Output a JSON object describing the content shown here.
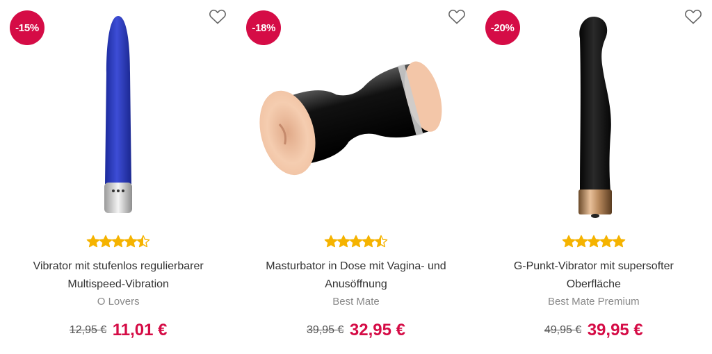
{
  "products": [
    {
      "discount": "-15%",
      "title_line1": "Vibrator mit stufenlos regulierbarer",
      "title_line2": "Multispeed-Vibration",
      "brand": "O Lovers",
      "old_price": "12,95 €",
      "new_price": "11,01 €",
      "rating": 4.5,
      "image": "blue-slim-vibrator"
    },
    {
      "discount": "-18%",
      "title_line1": "Masturbator in Dose mit Vagina- und",
      "title_line2": "Anusöffnung",
      "brand": "Best Mate",
      "old_price": "39,95 €",
      "new_price": "32,95 €",
      "rating": 4.5,
      "image": "double-masturbator"
    },
    {
      "discount": "-20%",
      "title_line1": "G-Punkt-Vibrator mit supersofter",
      "title_line2": "Oberfläche",
      "brand": "Best Mate Premium",
      "old_price": "49,95 €",
      "new_price": "39,95 €",
      "rating": 5,
      "image": "black-gspot-vibrator"
    }
  ],
  "colors": {
    "accent": "#d50c46",
    "star": "#f5b300",
    "brand_text": "#888888"
  },
  "icons": {
    "wishlist": "heart-outline-icon",
    "rating": "star-icon"
  }
}
